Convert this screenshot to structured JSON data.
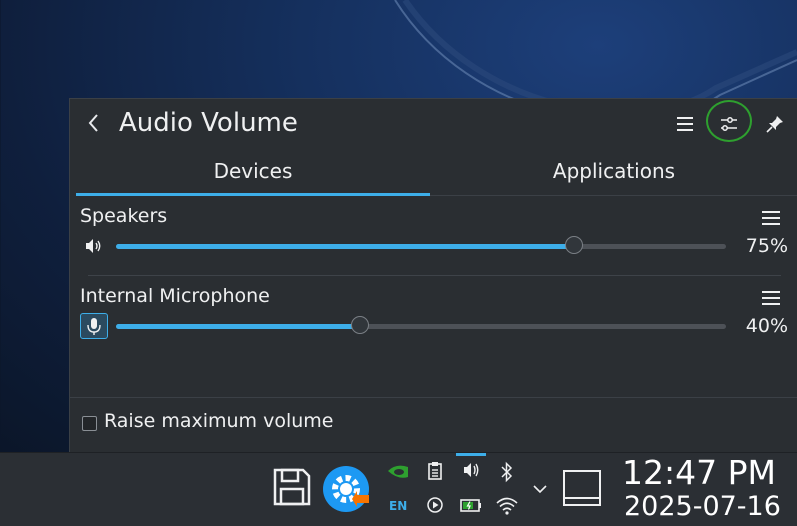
{
  "popup": {
    "title": "Audio Volume",
    "tabs": [
      {
        "label": "Devices",
        "active": true
      },
      {
        "label": "Applications",
        "active": false
      }
    ],
    "devices": [
      {
        "name": "Speakers",
        "volume_percent": 75,
        "volume_label": "75%",
        "icon": "speaker-icon"
      },
      {
        "name": "Internal Microphone",
        "volume_percent": 40,
        "volume_label": "40%",
        "icon": "microphone-icon"
      }
    ],
    "raise_max_volume": {
      "label": "Raise maximum volume",
      "checked": false
    }
  },
  "panel": {
    "tray": {
      "keyboard_layout": "EN"
    },
    "clock": {
      "time": "12:47 PM",
      "date": "2025-07-16"
    }
  },
  "colors": {
    "accent": "#3daee9",
    "highlight_ring": "#2ea02f",
    "popup_bg": "#2a2e32",
    "panel_bg": "#2b2f34"
  }
}
